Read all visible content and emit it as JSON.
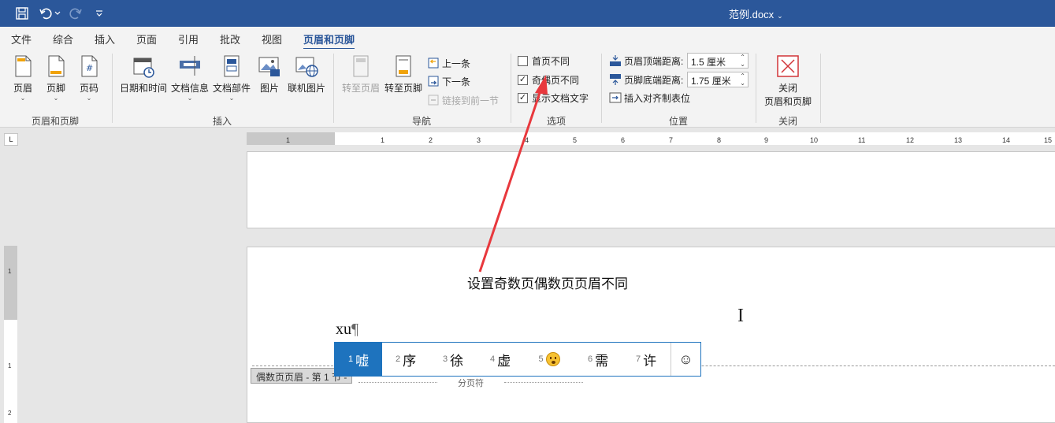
{
  "titlebar": {
    "doc_title": "范例.docx",
    "title_caret": "⌄",
    "accent": "#2b579a"
  },
  "tabs": [
    "文件",
    "综合",
    "插入",
    "页面",
    "引用",
    "批改",
    "视图",
    "页眉和页脚"
  ],
  "ribbon": {
    "hf_group": {
      "label": "页眉和页脚",
      "buttons": [
        "页眉",
        "页脚",
        "页码"
      ]
    },
    "insert_group": {
      "label": "插入",
      "buttons": [
        "日期和时间",
        "文档信息",
        "文档部件",
        "图片",
        "联机图片"
      ]
    },
    "nav_group": {
      "label": "导航",
      "goto_header": "转至页眉",
      "goto_footer": "转至页脚",
      "prev": "上一条",
      "next": "下一条",
      "link_prev": "链接到前一节"
    },
    "options_group": {
      "label": "选项",
      "first_page": "首页不同",
      "odd_even": "奇偶页不同",
      "show_doc_text": "显示文档文字"
    },
    "position_group": {
      "label": "位置",
      "header_top_label": "页眉顶端距离:",
      "header_top_value": "1.5 厘米",
      "footer_bottom_label": "页脚底端距离:",
      "footer_bottom_value": "1.75 厘米",
      "insert_align_tab": "插入对齐制表位"
    },
    "close_group": {
      "label": "关闭",
      "close_btn_line1": "关闭",
      "close_btn_line2": "页眉和页脚"
    }
  },
  "ruler": {
    "corner": "L",
    "ticks": [
      "1",
      "1",
      "2",
      "3",
      "4",
      "5",
      "6",
      "7",
      "8",
      "9",
      "10",
      "11",
      "12",
      "13",
      "14",
      "15"
    ]
  },
  "document": {
    "annotation": "设置奇数页偶数页页眉不同",
    "header_text": "xu",
    "pilcrow": "¶",
    "header_tag": "偶数页页眉 - 第 1 节 -",
    "page_break": "分页符",
    "ibeam": "I"
  },
  "ime": {
    "candidates": [
      {
        "num": "1",
        "text": "嘘"
      },
      {
        "num": "2",
        "text": "序"
      },
      {
        "num": "3",
        "text": "徐"
      },
      {
        "num": "4",
        "text": "虚"
      },
      {
        "num": "5",
        "text": ""
      },
      {
        "num": "6",
        "text": "需"
      },
      {
        "num": "7",
        "text": "许"
      }
    ],
    "emoji_button": "☺"
  }
}
